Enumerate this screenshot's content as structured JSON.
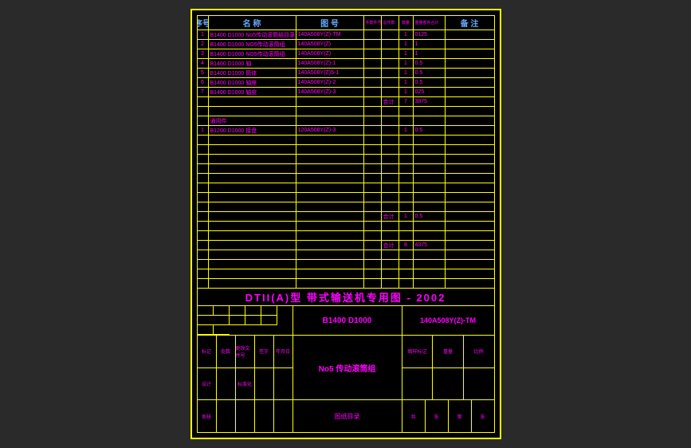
{
  "header": {
    "seq": "序号",
    "name": "名    称",
    "drawing": "图    号",
    "colA": "件数件号",
    "colB": "总件数",
    "colC": "数量",
    "colD": "重量部件合计",
    "colE": "备   注"
  },
  "rows": [
    {
      "seq": "1",
      "name": "B1400 D1000 No5传动滚筒结目录",
      "draw": "140A508Y(Z)-TM",
      "c": "1",
      "d": "0125"
    },
    {
      "seq": "2",
      "name": "B1400 D1000 NO5传动滚筒组",
      "draw": "140A508Y(Z)",
      "c": "1",
      "d": "1"
    },
    {
      "seq": "3",
      "name": "B1400 D1000 NO5传动滚筒组",
      "draw": "140A508Y(Z)",
      "c": "1",
      "d": "1"
    },
    {
      "seq": "4",
      "name": "B1400 D1000 轴",
      "draw": "140A508Y(Z)-1",
      "c": "1",
      "d": "0.5"
    },
    {
      "seq": "5",
      "name": "B1400 D1000 筒体",
      "draw": "140A508Y(Z)5-1",
      "c": "1",
      "d": "0.5"
    },
    {
      "seq": "6",
      "name": "B1400 D1000 轴座",
      "draw": "140A508Y(Z)-2",
      "c": "1",
      "d": "0.5"
    },
    {
      "seq": "7",
      "name": "B1400 D1000 轴皮",
      "draw": "140A508Y(Z)-3",
      "c": "1",
      "d": "025"
    }
  ],
  "subtotal1": {
    "label": "合计",
    "c": "7",
    "d": "3875"
  },
  "section2_label": "通用件",
  "rows2": [
    {
      "seq": "1",
      "name": "B1200 D1000 接盘",
      "draw": "120A508Y(Z)-3",
      "c": "1",
      "d": "0.5"
    }
  ],
  "subtotal2": {
    "label": "合计",
    "c": "1",
    "d": "0.5"
  },
  "subtotal3": {
    "label": "合计",
    "c": "8",
    "d": "4375"
  },
  "title": "DTII(A)型  带式输送机专用图 - 2002",
  "spec": "B1400  D1000",
  "code": "140A508Y(Z)-TM",
  "part_name": "No5 传动滚筒组",
  "footer_label": "图纸目录",
  "foot_labels": {
    "a1": "标记",
    "a2": "处数",
    "a3": "更改文件号",
    "a4": "签字",
    "a5": "年月日",
    "b1": "设计",
    "b2": "标准化",
    "b3": "图样标记",
    "b4": "重量",
    "b5": "比例",
    "c1": "审核",
    "c2": "",
    "c3": "共",
    "c4": "张",
    "c5": "第",
    "c6": "张"
  }
}
